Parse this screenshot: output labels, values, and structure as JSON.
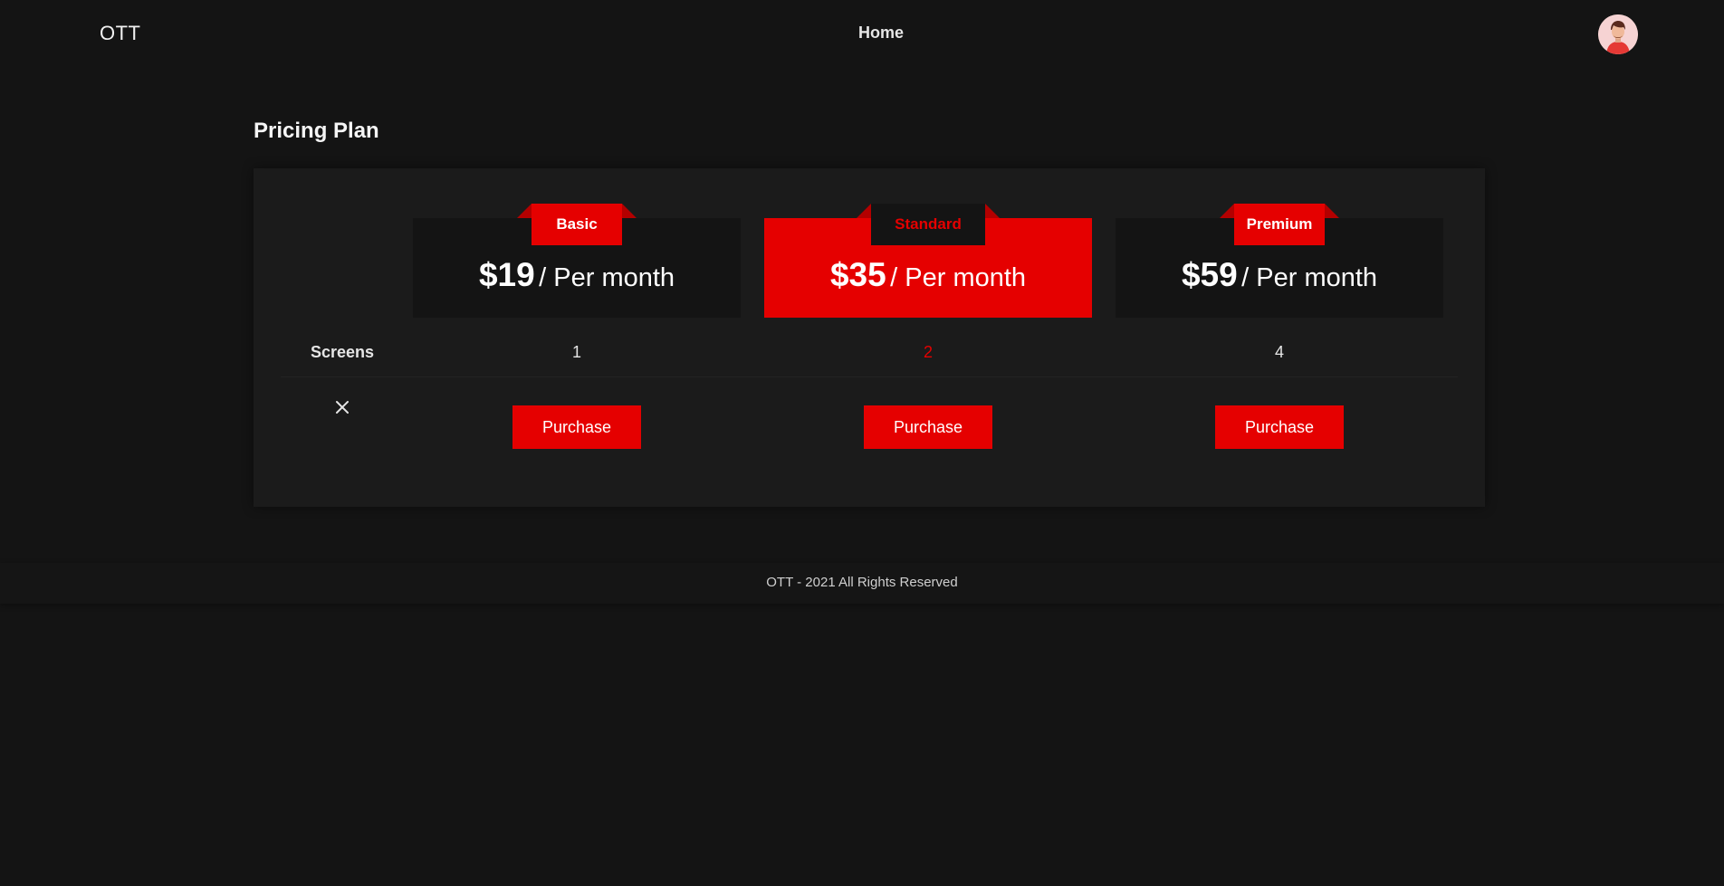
{
  "header": {
    "logo": "OTT",
    "nav_home": "Home",
    "avatar_icon": "user-avatar-icon"
  },
  "page": {
    "title": "Pricing Plan"
  },
  "plans": [
    {
      "name": "Basic",
      "price": "$19",
      "period": "/ Per month",
      "screens": "1",
      "button": "Purchase",
      "featured": false
    },
    {
      "name": "Standard",
      "price": "$35",
      "period": "/ Per month",
      "screens": "2",
      "button": "Purchase",
      "featured": true
    },
    {
      "name": "Premium",
      "price": "$59",
      "period": "/ Per month",
      "screens": "4",
      "button": "Purchase",
      "featured": false
    }
  ],
  "features": {
    "screens_label": "Screens",
    "close_icon": "close-icon"
  },
  "footer": {
    "text": "OTT - 2021 All Rights Reserved"
  },
  "colors": {
    "background": "#141414",
    "panel": "#1b1b1b",
    "accent": "#e50000",
    "text": "#e6e6e6"
  }
}
